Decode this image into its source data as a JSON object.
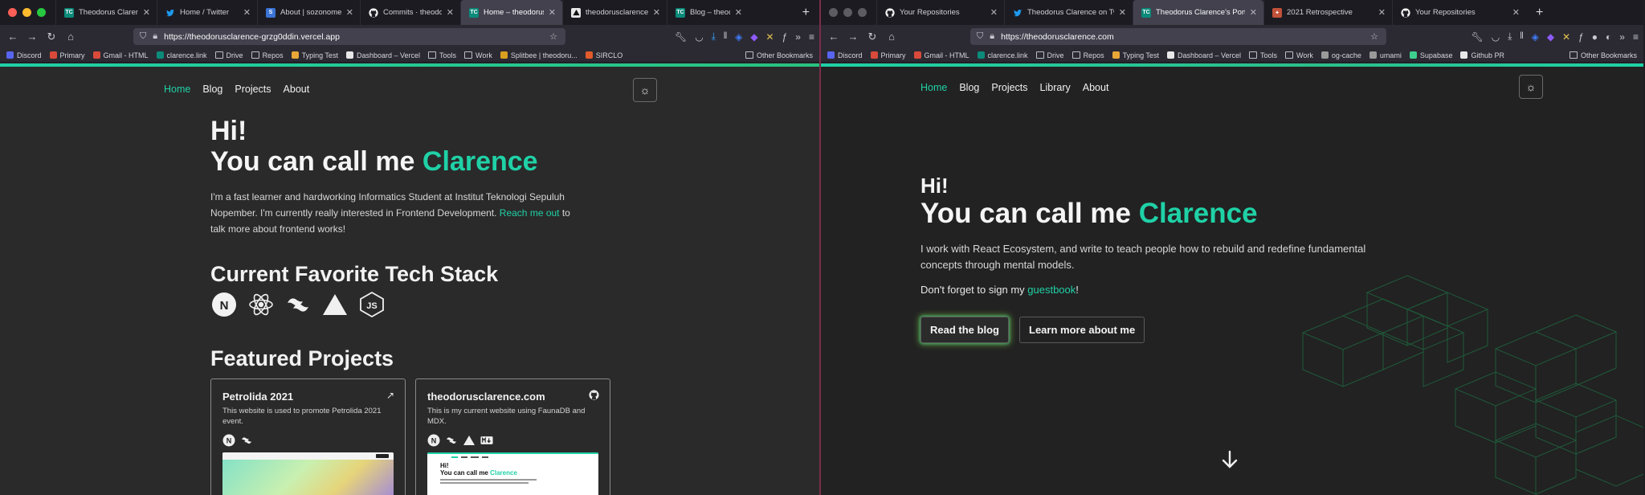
{
  "left": {
    "tabs": [
      {
        "title": "Theodorus Clarence's",
        "favicon": "TC",
        "favcolor": "#0c8a7a",
        "active": false
      },
      {
        "title": "Home / Twitter",
        "favicon": "twitter-bird",
        "favcolor": "#1d9bf0",
        "active": false
      },
      {
        "title": "About | sozonome",
        "favicon": "sozonome",
        "favcolor": "#3b73d6",
        "active": false
      },
      {
        "title": "Commits · theodorusclarence",
        "favicon": "github",
        "favcolor": "#ffffff",
        "active": false
      },
      {
        "title": "Home – theodorusclarence",
        "favicon": "TC",
        "favcolor": "#0c8a7a",
        "active": true
      },
      {
        "title": "theodorusclarence – Deployment",
        "favicon": "vercel",
        "favcolor": "#111111",
        "active": false
      },
      {
        "title": "Blog – theodorusclarence",
        "favicon": "TC",
        "favcolor": "#0c8a7a",
        "active": false
      }
    ],
    "url": "https://theodorusclarence-grzg0ddin.vercel.app",
    "bookmarks": [
      "Discord",
      "Primary",
      "Gmail - HTML",
      "clarence.link",
      "Drive",
      "Repos",
      "Typing Test",
      "Dashboard – Vercel",
      "Tools",
      "Work",
      "Splitbee | theodoru...",
      "SIRCLO"
    ],
    "other_bookmarks": "Other Bookmarks",
    "nav": [
      "Home",
      "Blog",
      "Projects",
      "About"
    ],
    "hero": {
      "hi": "Hi!",
      "line2": "You can call me ",
      "name": "Clarence",
      "para_a": "I'm a fast learner and hardworking Informatics Student at Institut Teknologi Sepuluh Nopember. I'm currently really interested in Frontend Development. ",
      "para_link": "Reach me out",
      "para_b": " to talk more about frontend works!"
    },
    "tech_heading": "Current Favorite Tech Stack",
    "tech_icons": [
      "nextjs-icon",
      "react-icon",
      "tailwind-icon",
      "vercel-icon",
      "nodejs-icon"
    ],
    "projects_heading": "Featured Projects",
    "projects": [
      {
        "title": "Petrolida 2021",
        "desc": "This website is used to promote Petrolida 2021 event.",
        "corner_icon": "external-link-icon"
      },
      {
        "title": "theodorusclarence.com",
        "desc": "This is my current website using FaunaDB and MDX.",
        "corner_icon": "github-icon"
      }
    ],
    "thumb2": {
      "hi": "Hi!",
      "line2": "You can call me ",
      "name": "Clarence"
    }
  },
  "right": {
    "tabs": [
      {
        "title": "Your Repositories",
        "favicon": "github",
        "favcolor": "#ffffff",
        "active": false
      },
      {
        "title": "Theodorus Clarence on Twitter",
        "favicon": "twitter-bird",
        "favcolor": "#1d9bf0",
        "active": false
      },
      {
        "title": "Theodorus Clarence's Portfolio",
        "favicon": "TC",
        "favcolor": "#0c8a7a",
        "active": true
      },
      {
        "title": "2021 Retrospective",
        "favicon": "retro",
        "favcolor": "#c2513a",
        "active": false
      },
      {
        "title": "Your Repositories",
        "favicon": "github",
        "favcolor": "#ffffff",
        "active": false
      }
    ],
    "url": "https://theodorusclarence.com",
    "bookmarks": [
      "Discord",
      "Primary",
      "Gmail - HTML",
      "clarence.link",
      "Drive",
      "Repos",
      "Typing Test",
      "Dashboard – Vercel",
      "Tools",
      "Work",
      "og-cache",
      "umami",
      "Supabase",
      "Github PR"
    ],
    "other_bookmarks": "Other Bookmarks",
    "nav": [
      "Home",
      "Blog",
      "Projects",
      "Library",
      "About"
    ],
    "hero": {
      "hi": "Hi!",
      "line2": "You can call me ",
      "name": "Clarence",
      "para1": "I work with React Ecosystem, and write to teach people how to rebuild and redefine fundamental concepts through mental models.",
      "para2_a": "Don't forget to sign my ",
      "para2_link": "guestbook",
      "para2_b": "!"
    },
    "buttons": {
      "primary": "Read the blog",
      "secondary": "Learn more about me"
    }
  },
  "colors": {
    "accent": "#1fd1a6",
    "glow": "#8bdc4f",
    "close_red": "#ff5f57",
    "min_yellow": "#febc2e",
    "max_green": "#28c840"
  }
}
